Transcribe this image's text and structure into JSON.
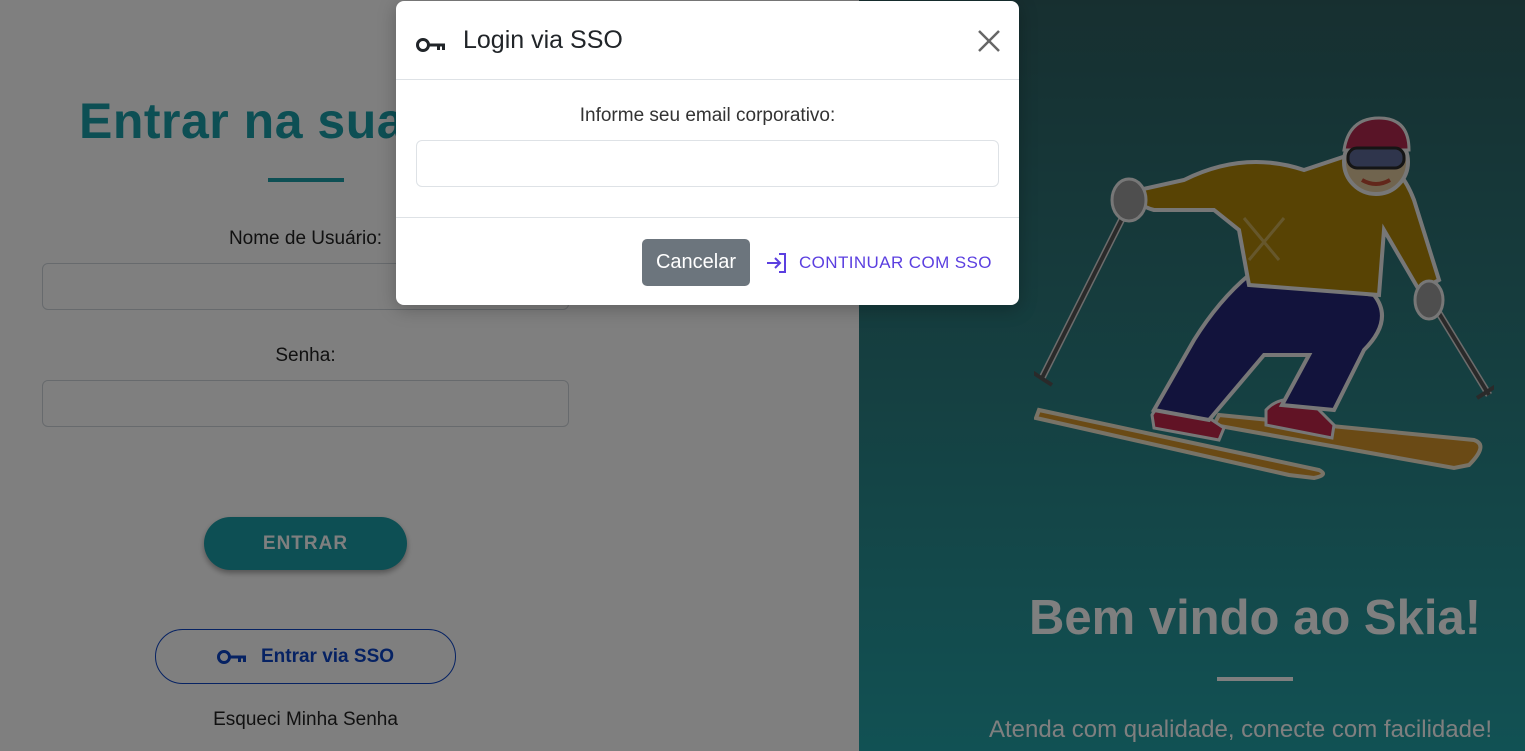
{
  "login": {
    "title": "Entrar na sua conta",
    "username_label": "Nome de Usuário:",
    "username_value": "",
    "password_label": "Senha:",
    "password_value": "",
    "submit_label": "ENTRAR",
    "sso_label": "Entrar via SSO",
    "forgot_label": "Esqueci Minha Senha"
  },
  "hero": {
    "title": "Bem vindo ao Skia!",
    "subtitle": "Atenda com qualidade, conecte com facilidade!"
  },
  "modal": {
    "title": "Login via SSO",
    "email_label": "Informe seu email corporativo:",
    "email_value": "",
    "cancel_label": "Cancelar",
    "continue_label": "CONTINUAR COM SSO"
  },
  "colors": {
    "brand_teal": "#1b9ea8",
    "sso_blue": "#0d45c7",
    "continue_purple": "#5b3fe0",
    "cancel_gray": "#6c757d"
  },
  "icons": {
    "modal_title_icon": "key-icon",
    "close_icon": "close-icon",
    "continue_icon": "sign-in-icon",
    "sso_button_icon": "key-icon"
  }
}
